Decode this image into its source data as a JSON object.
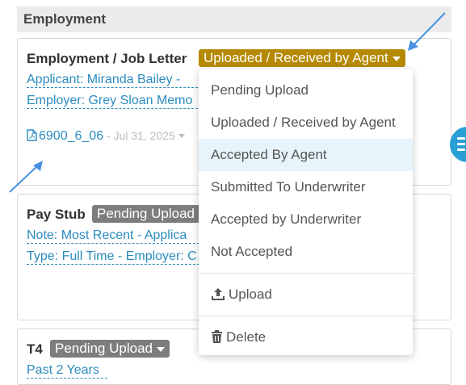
{
  "section": {
    "title": "Employment"
  },
  "cards": {
    "employment": {
      "title": "Employment / Job Letter",
      "status": "Uploaded / Received by Agent",
      "links": [
        "Applicant: Miranda Bailey - ",
        "Employer: Grey Sloan Memo"
      ],
      "file": {
        "name": "6900_6_06",
        "separator": " - ",
        "date": "Jul 31, 2025"
      }
    },
    "paystub": {
      "title": "Pay Stub",
      "status": "Pending Upload",
      "links": [
        "Note: Most Recent - Applica",
        "Type: Full Time - Employer: C"
      ]
    },
    "t4": {
      "title": "T4",
      "status": "Pending Upload",
      "links": [
        "Past 2 Years"
      ]
    }
  },
  "dropdown": {
    "status_options": [
      "Pending Upload",
      "Uploaded / Received by Agent",
      "Accepted By Agent",
      "Submitted To Underwriter",
      "Accepted by Underwriter",
      "Not Accepted"
    ],
    "active_option": "Accepted By Agent",
    "upload_label": "Upload",
    "delete_label": "Delete"
  },
  "colors": {
    "accent_link": "#2a8cbf",
    "badge_uploaded": "#b58900",
    "badge_pending": "#7d7d7d",
    "fab": "#2a9fd6",
    "annotation_arrow": "#4a90e2"
  },
  "icons": [
    "pdf-file-icon",
    "upload-icon",
    "trash-icon",
    "caret-down-icon",
    "menu-icon"
  ]
}
